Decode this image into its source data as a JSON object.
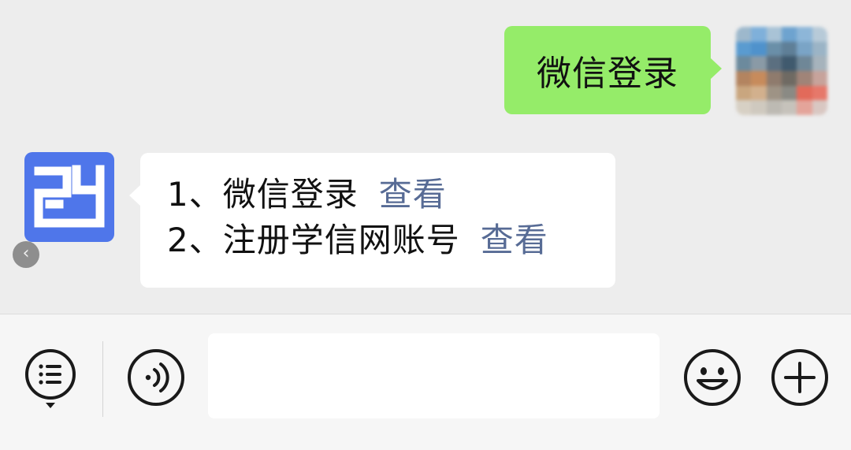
{
  "chat": {
    "sent_message": "微信登录",
    "received_message": {
      "lines": [
        {
          "text": "1、微信登录",
          "link": "查看"
        },
        {
          "text": "2、注册学信网账号",
          "link": "查看"
        }
      ]
    }
  },
  "avatars": {
    "user": "blurred-user-avatar",
    "bot": "chsi-logo"
  },
  "input_bar": {
    "menu_icon": "menu-list-icon",
    "voice_icon": "voice-icon",
    "input_value": "",
    "emoji_icon": "emoji-icon",
    "plus_icon": "plus-icon"
  },
  "colors": {
    "chat_background": "#ededed",
    "sent_bubble": "#95ec69",
    "received_bubble": "#ffffff",
    "link": "#576b95",
    "bot_avatar": "#4f76ea",
    "input_bar": "#f6f6f6"
  }
}
